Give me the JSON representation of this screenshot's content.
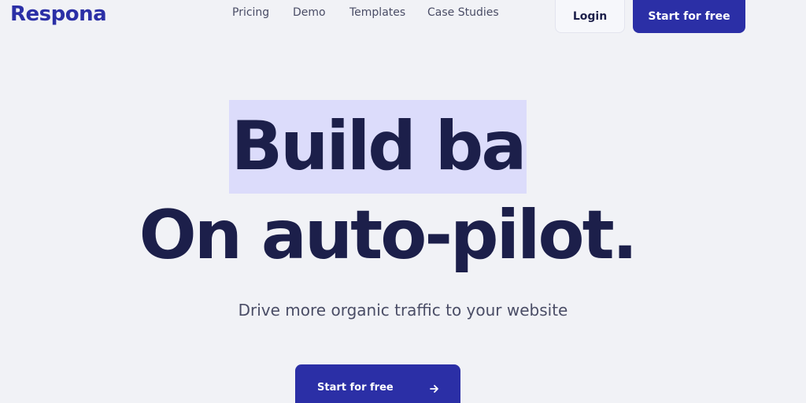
{
  "header": {
    "logo": "Respona",
    "nav": [
      "Pricing",
      "Demo",
      "Templates",
      "Case Studies"
    ],
    "login_label": "Login",
    "start_label": "Start for free"
  },
  "hero": {
    "line1": "Build ba",
    "line2": "On auto-pilot.",
    "subtitle": "Drive more organic traffic to your website"
  },
  "cta": {
    "label": "Start for free",
    "icon": "arrow-right-icon"
  },
  "colors": {
    "brand": "#2b2fa6",
    "heading": "#1c1f4a",
    "highlight": "#dcdcfb",
    "background": "#f1f2f6"
  }
}
